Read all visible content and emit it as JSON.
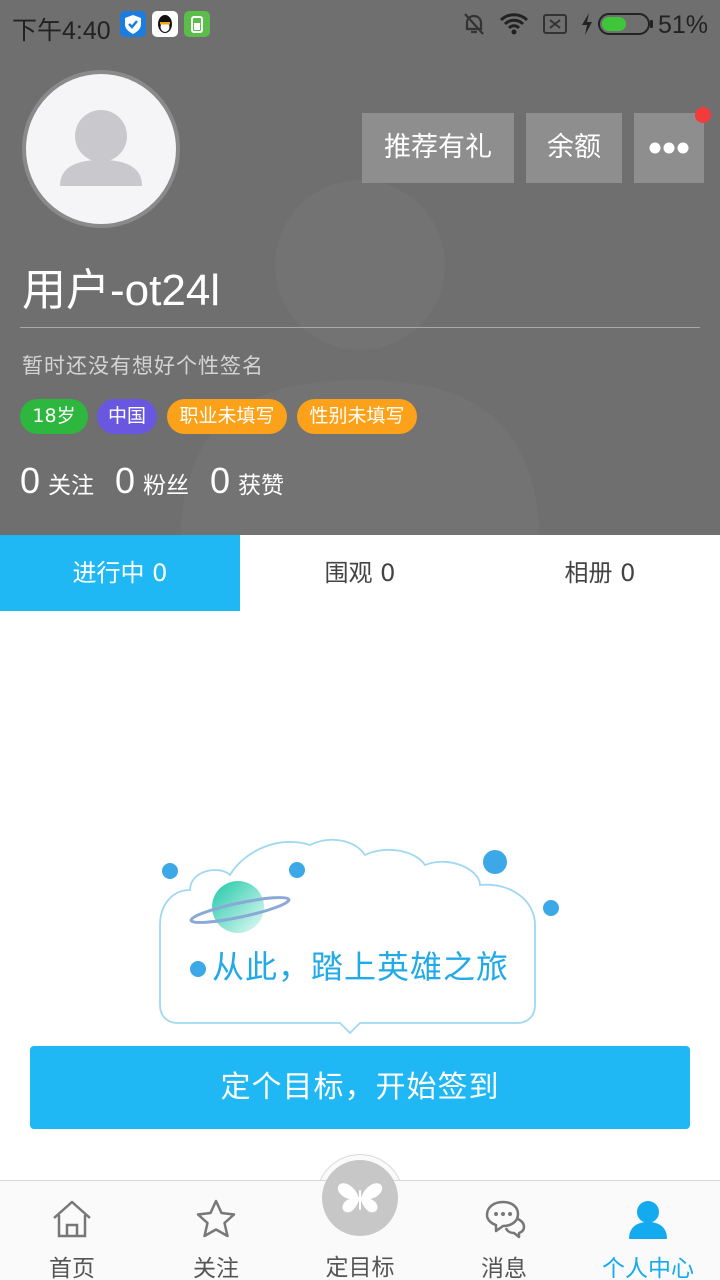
{
  "status_bar": {
    "time": "下午4:40",
    "battery_percent": "51%"
  },
  "header": {
    "username": "用户-ot24l",
    "signature": "暂时还没有想好个性签名",
    "buttons": {
      "recommend": "推荐有礼",
      "balance": "余额"
    },
    "tags": {
      "age": "18岁",
      "country": "中国",
      "job": "职业未填写",
      "gender": "性别未填写"
    },
    "stats": {
      "following_num": "0",
      "following_label": "关注",
      "fans_num": "0",
      "fans_label": "粉丝",
      "likes_num": "0",
      "likes_label": "获赞"
    }
  },
  "tabs": {
    "in_progress": "进行中 0",
    "watching": "围观 0",
    "album": "相册 0"
  },
  "empty_state": {
    "slogan": "从此，踏上英雄之旅",
    "cta": "定个目标，开始签到"
  },
  "bottom_nav": {
    "home": "首页",
    "follow": "关注",
    "set_goal": "定目标",
    "messages": "消息",
    "profile": "个人中心"
  },
  "colors": {
    "accent": "#1fb8f5",
    "header_bg": "#6f6f6f",
    "tag_green": "#2eb73e",
    "tag_purple": "#6a57e0",
    "tag_orange": "#fba21a",
    "notify_red": "#f23b3b"
  }
}
